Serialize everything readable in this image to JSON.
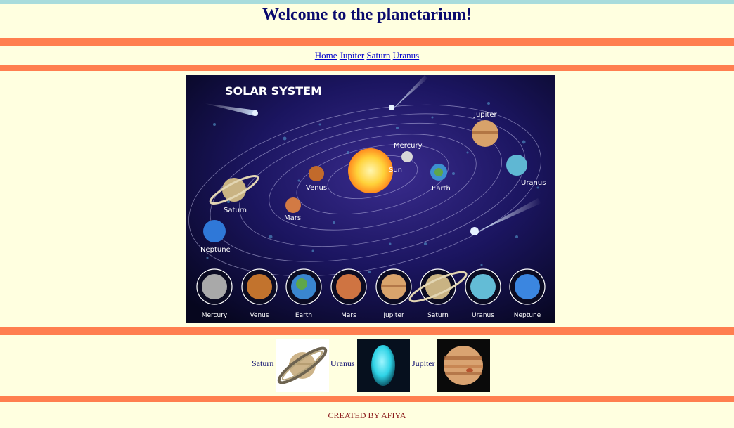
{
  "page": {
    "title": "Welcome to the planetarium!",
    "footer": "CREATED BY AFIYA"
  },
  "nav": {
    "links": [
      "Home",
      "Jupiter",
      "Saturn",
      "Uranus"
    ]
  },
  "hero": {
    "heading": "SOLAR SYSTEM",
    "orbit_labels": {
      "sun": "Sun",
      "mercury": "Mercury",
      "venus": "Venus",
      "earth": "Earth",
      "mars": "Mars",
      "jupiter": "Jupiter",
      "saturn": "Saturn",
      "uranus": "Uranus",
      "neptune": "Neptune"
    },
    "bottom_planets": [
      "Mercury",
      "Venus",
      "Earth",
      "Mars",
      "Jupiter",
      "Saturn",
      "Uranus",
      "Neptune"
    ]
  },
  "thumbnails": [
    {
      "label": "Saturn"
    },
    {
      "label": "Uranus"
    },
    {
      "label": "Jupiter"
    }
  ],
  "colors": {
    "background": "#ffffe0",
    "rule": "#ff7f50",
    "title": "#0a0a6e",
    "link": "#0000cc",
    "footer": "#8b1a1a"
  }
}
